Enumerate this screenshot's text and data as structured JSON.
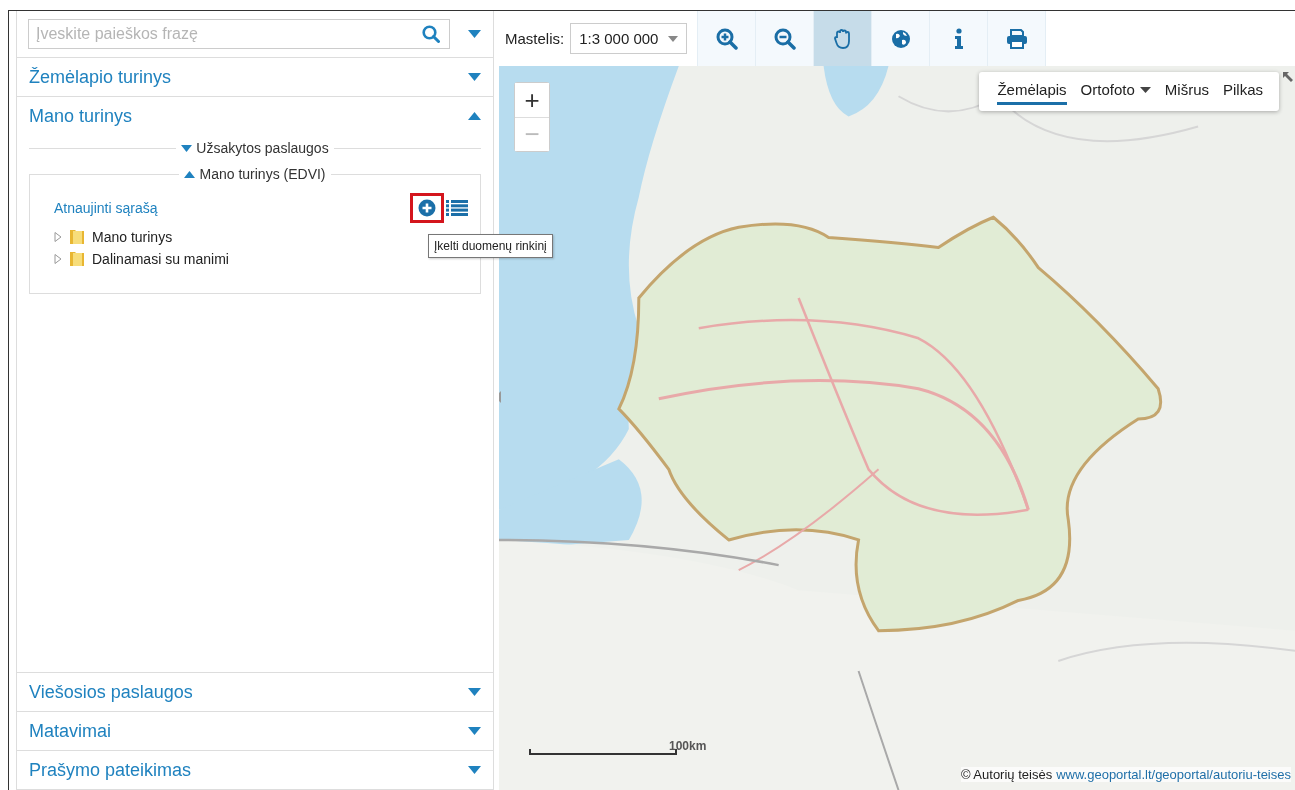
{
  "search": {
    "placeholder": "Įveskite paieškos frazę"
  },
  "sections": [
    {
      "title": "Žemėlapio turinys",
      "expanded": false
    },
    {
      "title": "Mano turinys",
      "expanded": true,
      "subsections": [
        {
          "title": "Užsakytos paslaugos",
          "expanded": false
        },
        {
          "title": "Mano turinys (EDVI)",
          "expanded": true,
          "refresh_link": "Atnaujinti sąrašą",
          "tooltip": "Įkelti duomenų rinkinį",
          "tree": [
            {
              "label": "Mano turinys",
              "expanded": false
            },
            {
              "label": "Dalinamasi su manimi",
              "expanded": false
            }
          ]
        }
      ]
    },
    {
      "title": "Viešosios paslaugos",
      "expanded": false
    },
    {
      "title": "Matavimai",
      "expanded": false
    },
    {
      "title": "Prašymo pateikimas",
      "expanded": false
    }
  ],
  "toolbar": {
    "scale_label": "Mastelis:",
    "scale_value": "1:3 000 000",
    "tools": [
      {
        "kind": "zoom-in",
        "selected": false
      },
      {
        "kind": "zoom-out",
        "selected": false
      },
      {
        "kind": "pan",
        "selected": true
      },
      {
        "kind": "globe",
        "selected": false
      },
      {
        "kind": "info",
        "selected": false
      },
      {
        "kind": "print",
        "selected": false
      }
    ]
  },
  "map": {
    "zoom_in": "+",
    "zoom_out": "−",
    "layers": [
      {
        "label": "Žemėlapis",
        "selected": true,
        "dropdown": false
      },
      {
        "label": "Ortofoto",
        "selected": false,
        "dropdown": true
      },
      {
        "label": "Mišrus",
        "selected": false,
        "dropdown": false
      },
      {
        "label": "Pilkas",
        "selected": false,
        "dropdown": false
      }
    ],
    "scale_bar": "100km",
    "attribution": "© Autorių teisės",
    "attribution_link": "www.geoportal.lt/geoportal/autoriu-teises"
  }
}
